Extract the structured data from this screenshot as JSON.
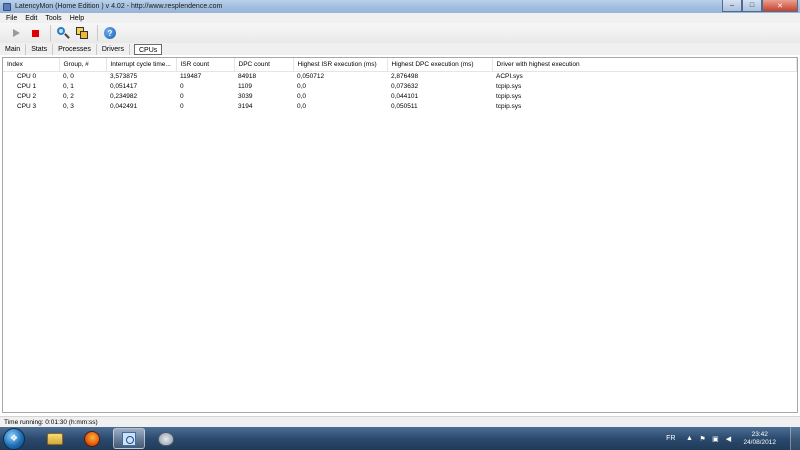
{
  "window": {
    "title": "LatencyMon  (Home Edition )  v 4.02 - http://www.resplendence.com",
    "controls": {
      "minimize": "–",
      "maximize": "□",
      "close": "✕"
    }
  },
  "menu": [
    "File",
    "Edit",
    "Tools",
    "Help"
  ],
  "toolbar": {
    "icons": [
      "play-icon",
      "stop-icon",
      "search-icon",
      "copy-icon",
      "help-icon"
    ],
    "help_glyph": "?"
  },
  "tabs": [
    "Main",
    "Stats",
    "Processes",
    "Drivers",
    "CPUs"
  ],
  "active_tab": "CPUs",
  "table": {
    "columns": [
      "Index",
      "Group, #",
      "Interrupt cycle time...",
      "ISR count",
      "DPC count",
      "Highest ISR execution (ms)",
      "Highest DPC execution (ms)",
      "Driver with highest execution"
    ],
    "rows": [
      [
        "CPU 0",
        "0, 0",
        "3,573875",
        "119487",
        "84918",
        "0,050712",
        "2,876498",
        "ACPI.sys"
      ],
      [
        "CPU 1",
        "0, 1",
        "0,051417",
        "0",
        "1109",
        "0,0",
        "0,073632",
        "tcpip.sys"
      ],
      [
        "CPU 2",
        "0, 2",
        "0,234982",
        "0",
        "3039",
        "0,0",
        "0,044101",
        "tcpip.sys"
      ],
      [
        "CPU 3",
        "0, 3",
        "0,042491",
        "0",
        "3194",
        "0,0",
        "0,050511",
        "tcpip.sys"
      ]
    ]
  },
  "status": {
    "text": "Time running: 0:01:30  (h:mm:ss)"
  },
  "taskbar": {
    "start_glyph": "❖",
    "apps": [
      "windows-explorer-icon",
      "firefox-icon",
      "latencymon-icon",
      "paint-icon"
    ],
    "language": "FR",
    "tray_icons": [
      "up-arrow-icon",
      "action-center-icon",
      "network-icon",
      "volume-icon"
    ],
    "time": "23:42",
    "date": "24/08/2012"
  },
  "colors": {
    "taskbar": "#2b4a6e",
    "titlebar": "#a6c1e0",
    "stop": "#e00000"
  }
}
